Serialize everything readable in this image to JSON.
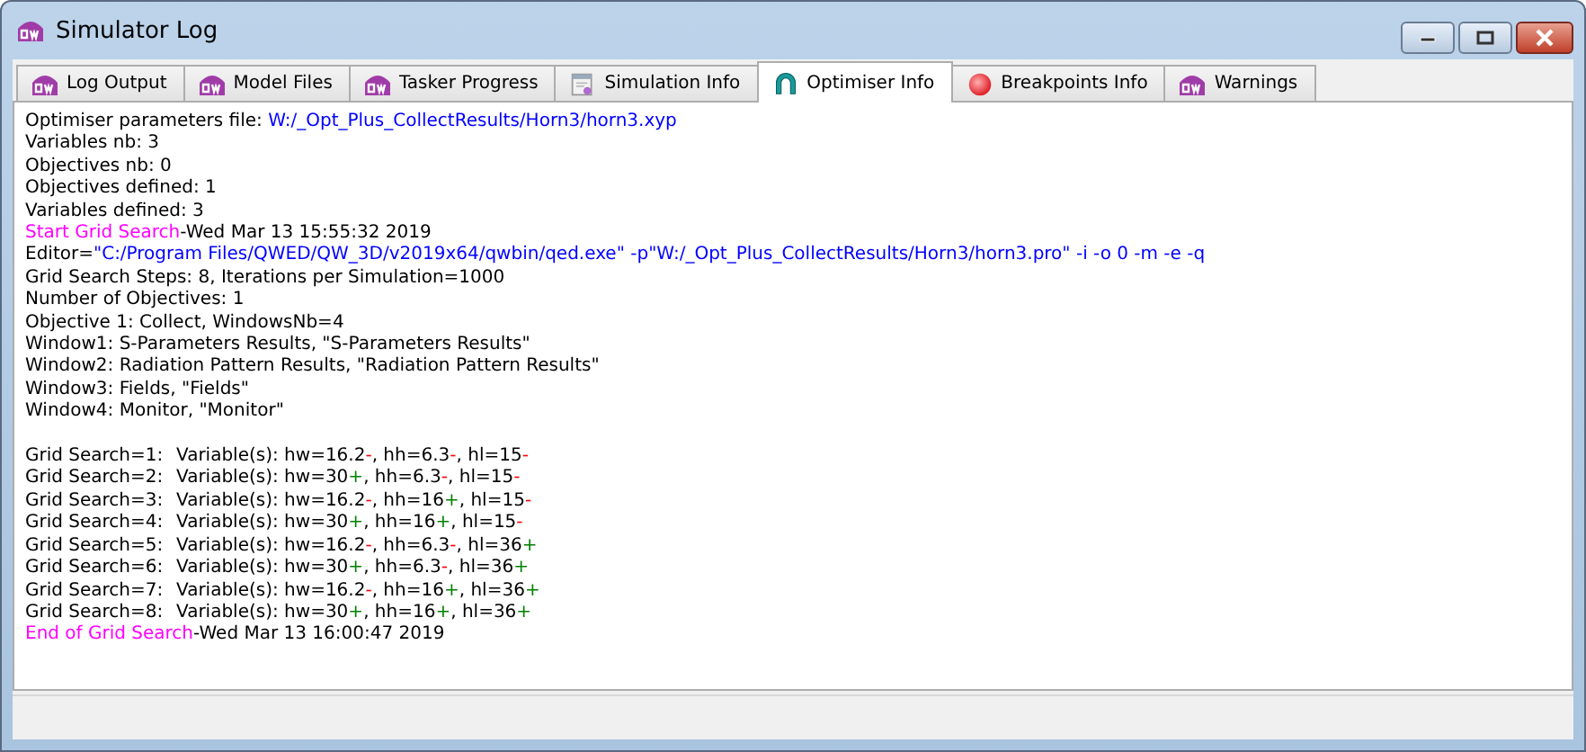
{
  "window": {
    "title": "Simulator Log"
  },
  "tabs": [
    {
      "label": "Log Output",
      "kind": "logo",
      "selected": false
    },
    {
      "label": "Model Files",
      "kind": "logo",
      "selected": false
    },
    {
      "label": "Tasker Progress",
      "kind": "logo",
      "selected": false
    },
    {
      "label": "Simulation Info",
      "kind": "document",
      "selected": false
    },
    {
      "label": "Optimiser Info",
      "kind": "arch",
      "selected": true
    },
    {
      "label": "Breakpoints Info",
      "kind": "dot",
      "selected": false
    },
    {
      "label": "Warnings",
      "kind": "logo",
      "selected": false
    }
  ],
  "log": [
    {
      "kind": "text",
      "segments": [
        {
          "text": "Optimiser parameters file: ",
          "color": "#000000"
        },
        {
          "text": "W:/_Opt_Plus_CollectResults/Horn3/horn3.xyp",
          "color": "#0000ff"
        }
      ]
    },
    {
      "kind": "text",
      "segments": [
        {
          "text": "Variables nb: 3",
          "color": "#000000"
        }
      ]
    },
    {
      "kind": "text",
      "segments": [
        {
          "text": "Objectives nb: 0",
          "color": "#000000"
        }
      ]
    },
    {
      "kind": "text",
      "segments": [
        {
          "text": "Objectives defined: 1",
          "color": "#000000"
        }
      ]
    },
    {
      "kind": "text",
      "segments": [
        {
          "text": "Variables defined: 3",
          "color": "#000000"
        }
      ]
    },
    {
      "kind": "text",
      "segments": [
        {
          "text": "Start Grid Search",
          "color": "#ff00ff"
        },
        {
          "text": "-Wed Mar 13 15:55:32 2019",
          "color": "#000000"
        }
      ]
    },
    {
      "kind": "text",
      "segments": [
        {
          "text": "Editor=",
          "color": "#000000"
        },
        {
          "text": "\"C:/Program Files/QWED/QW_3D/v2019x64/qwbin/qed.exe\" -p\"W:/_Opt_Plus_CollectResults/Horn3/horn3.pro\" -i -o 0 -m -e -q",
          "color": "#0000ff"
        }
      ]
    },
    {
      "kind": "text",
      "segments": [
        {
          "text": "Grid Search Steps: 8, Iterations per Simulation=1000",
          "color": "#000000"
        }
      ]
    },
    {
      "kind": "text",
      "segments": [
        {
          "text": "Number of Objectives: 1",
          "color": "#000000"
        }
      ]
    },
    {
      "kind": "text",
      "segments": [
        {
          "text": "Objective 1: Collect, WindowsNb=4",
          "color": "#000000"
        }
      ]
    },
    {
      "kind": "text",
      "segments": [
        {
          "text": "Window1: S-Parameters Results, \"S-Parameters Results\"",
          "color": "#000000"
        }
      ]
    },
    {
      "kind": "text",
      "segments": [
        {
          "text": "Window2: Radiation Pattern Results, \"Radiation Pattern Results\"",
          "color": "#000000"
        }
      ]
    },
    {
      "kind": "text",
      "segments": [
        {
          "text": "Window3: Fields, \"Fields\"",
          "color": "#000000"
        }
      ]
    },
    {
      "kind": "text",
      "segments": [
        {
          "text": "Window4: Monitor, \"Monitor\"",
          "color": "#000000"
        }
      ]
    },
    {
      "kind": "blank"
    },
    {
      "kind": "grid",
      "label": "Grid Search=1:",
      "segments": [
        {
          "text": "Variable(s): hw=16.2",
          "color": "#000000"
        },
        {
          "text": "-",
          "color": "#ff0000"
        },
        {
          "text": ", hh=6.3",
          "color": "#000000"
        },
        {
          "text": "-",
          "color": "#ff0000"
        },
        {
          "text": ", hl=15",
          "color": "#000000"
        },
        {
          "text": "-",
          "color": "#ff0000"
        }
      ]
    },
    {
      "kind": "grid",
      "label": "Grid Search=2:",
      "segments": [
        {
          "text": "Variable(s): hw=30",
          "color": "#000000"
        },
        {
          "text": "+",
          "color": "#008000"
        },
        {
          "text": ", hh=6.3",
          "color": "#000000"
        },
        {
          "text": "-",
          "color": "#ff0000"
        },
        {
          "text": ", hl=15",
          "color": "#000000"
        },
        {
          "text": "-",
          "color": "#ff0000"
        }
      ]
    },
    {
      "kind": "grid",
      "label": "Grid Search=3:",
      "segments": [
        {
          "text": "Variable(s): hw=16.2",
          "color": "#000000"
        },
        {
          "text": "-",
          "color": "#ff0000"
        },
        {
          "text": ", hh=16",
          "color": "#000000"
        },
        {
          "text": "+",
          "color": "#008000"
        },
        {
          "text": ", hl=15",
          "color": "#000000"
        },
        {
          "text": "-",
          "color": "#ff0000"
        }
      ]
    },
    {
      "kind": "grid",
      "label": "Grid Search=4:",
      "segments": [
        {
          "text": "Variable(s): hw=30",
          "color": "#000000"
        },
        {
          "text": "+",
          "color": "#008000"
        },
        {
          "text": ", hh=16",
          "color": "#000000"
        },
        {
          "text": "+",
          "color": "#008000"
        },
        {
          "text": ", hl=15",
          "color": "#000000"
        },
        {
          "text": "-",
          "color": "#ff0000"
        }
      ]
    },
    {
      "kind": "grid",
      "label": "Grid Search=5:",
      "segments": [
        {
          "text": "Variable(s): hw=16.2",
          "color": "#000000"
        },
        {
          "text": "-",
          "color": "#ff0000"
        },
        {
          "text": ", hh=6.3",
          "color": "#000000"
        },
        {
          "text": "-",
          "color": "#ff0000"
        },
        {
          "text": ", hl=36",
          "color": "#000000"
        },
        {
          "text": "+",
          "color": "#008000"
        }
      ]
    },
    {
      "kind": "grid",
      "label": "Grid Search=6:",
      "segments": [
        {
          "text": "Variable(s): hw=30",
          "color": "#000000"
        },
        {
          "text": "+",
          "color": "#008000"
        },
        {
          "text": ", hh=6.3",
          "color": "#000000"
        },
        {
          "text": "-",
          "color": "#ff0000"
        },
        {
          "text": ", hl=36",
          "color": "#000000"
        },
        {
          "text": "+",
          "color": "#008000"
        }
      ]
    },
    {
      "kind": "grid",
      "label": "Grid Search=7:",
      "segments": [
        {
          "text": "Variable(s): hw=16.2",
          "color": "#000000"
        },
        {
          "text": "-",
          "color": "#ff0000"
        },
        {
          "text": ", hh=16",
          "color": "#000000"
        },
        {
          "text": "+",
          "color": "#008000"
        },
        {
          "text": ", hl=36",
          "color": "#000000"
        },
        {
          "text": "+",
          "color": "#008000"
        }
      ]
    },
    {
      "kind": "grid",
      "label": "Grid Search=8:",
      "segments": [
        {
          "text": "Variable(s): hw=30",
          "color": "#000000"
        },
        {
          "text": "+",
          "color": "#008000"
        },
        {
          "text": ", hh=16",
          "color": "#000000"
        },
        {
          "text": "+",
          "color": "#008000"
        },
        {
          "text": ", hl=36",
          "color": "#000000"
        },
        {
          "text": "+",
          "color": "#008000"
        }
      ]
    },
    {
      "kind": "text",
      "segments": [
        {
          "text": "End of Grid Search",
          "color": "#ff00ff"
        },
        {
          "text": "-Wed Mar 13 16:00:47 2019",
          "color": "#000000"
        }
      ]
    }
  ]
}
